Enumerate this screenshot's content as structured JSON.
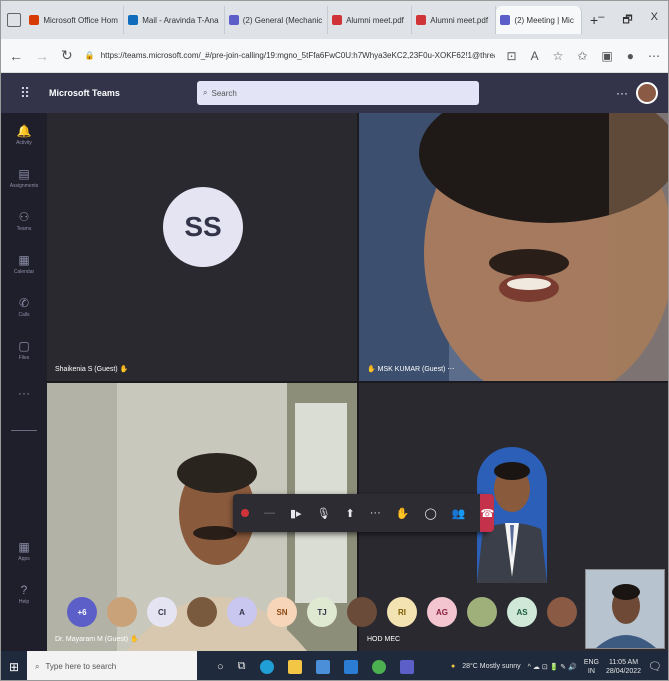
{
  "browser": {
    "tabs": [
      {
        "label": "Microsoft Office Hom",
        "color": "#d83b01",
        "active": false
      },
      {
        "label": "Mail - Aravinda T-Ana",
        "color": "#0f6cbd",
        "active": false
      },
      {
        "label": "(2) General (Mechanic",
        "color": "#5b5fc7",
        "active": false
      },
      {
        "label": "Alumni meet.pdf",
        "color": "#d13438",
        "active": false
      },
      {
        "label": "Alumni meet.pdf",
        "color": "#d13438",
        "active": false
      },
      {
        "label": "(2) Meeting | Mic",
        "color": "#5b5fc7",
        "active": true
      }
    ],
    "new_tab": "+",
    "minimize": "–",
    "restore": "🗗",
    "close": "X",
    "url": "https://teams.microsoft.com/_#/pre-join-calling/19:mgno_5tFfa6FwC0U:h7Whya3eKC2,23F0u-XOKF62!1@thread.tacv2"
  },
  "teams": {
    "app_title": "Microsoft Teams",
    "search_placeholder": "Search",
    "rail": [
      {
        "label": "Activity",
        "icon": "🔔"
      },
      {
        "label": "Assignments",
        "icon": "▤"
      },
      {
        "label": "Teams",
        "icon": "⚇"
      },
      {
        "label": "Calendar",
        "icon": "▦"
      },
      {
        "label": "Calls",
        "icon": "✆"
      },
      {
        "label": "Files",
        "icon": "▢"
      }
    ],
    "rail_bottom": [
      {
        "label": "Apps",
        "icon": "▦"
      },
      {
        "label": "Help",
        "icon": "?"
      }
    ]
  },
  "tiles": [
    {
      "initials": "SS",
      "name": "Shaikenia S (Guest)"
    },
    {
      "name": "MSK KUMAR (Guest)"
    },
    {
      "name": "Dr. Mayaram M (Guest)"
    },
    {
      "name": "HOD MEC"
    }
  ],
  "controls": {
    "more": "···",
    "hangup": "☎"
  },
  "roster": [
    {
      "label": "+6",
      "bg": "#5b5fc7",
      "fg": "#ffffff"
    },
    {
      "label": "",
      "bg": "#c9a27a",
      "fg": "#33344a"
    },
    {
      "label": "CI",
      "bg": "#e5e4f2",
      "fg": "#33344a"
    },
    {
      "label": "",
      "bg": "#7a5a3f",
      "fg": "#33344a"
    },
    {
      "label": "A",
      "bg": "#c9c6f0",
      "fg": "#33344a"
    },
    {
      "label": "SN",
      "bg": "#f6d5b8",
      "fg": "#8a4b16"
    },
    {
      "label": "TJ",
      "bg": "#dfe8d0",
      "fg": "#33344a"
    },
    {
      "label": "",
      "bg": "#6a4a38",
      "fg": "#33344a"
    },
    {
      "label": "RI",
      "bg": "#f4e3b2",
      "fg": "#7a5a00"
    },
    {
      "label": "AG",
      "bg": "#f2c5d0",
      "fg": "#8a2040"
    },
    {
      "label": "",
      "bg": "#9fb07a",
      "fg": "#33344a"
    },
    {
      "label": "AS",
      "bg": "#cfe8d8",
      "fg": "#1e5b3a"
    },
    {
      "label": "",
      "bg": "#8a5a44",
      "fg": "#33344a"
    }
  ],
  "taskbar": {
    "search_placeholder": "Type here to search",
    "weather": "28°C Mostly sunny",
    "lang": "ENG",
    "lang2": "IN",
    "time": "11:05 AM",
    "date": "28/04/2022"
  }
}
